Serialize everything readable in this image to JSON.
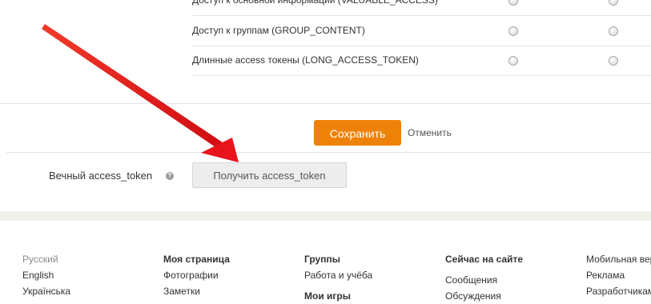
{
  "permissions": {
    "rows": [
      {
        "label": "Доступ к основной информации (VALUABLE_ACCESS)"
      },
      {
        "label": "Доступ к группам (GROUP_CONTENT)"
      },
      {
        "label": "Длинные access токены (LONG_ACCESS_TOKEN)"
      }
    ]
  },
  "actions": {
    "save_label": "Сохранить",
    "cancel_label": "Отменить"
  },
  "token": {
    "label": "Вечный access_token",
    "help_glyph": "?",
    "button_label": "Получить access_token"
  },
  "footer": {
    "languages": [
      "Русский",
      "English",
      "Українська"
    ],
    "col_my_page": {
      "title": "Моя страница",
      "items": [
        "Фотографии",
        "Заметки"
      ]
    },
    "col_groups": {
      "title": "Группы",
      "items": [
        "Работа и учёба"
      ],
      "title2": "Мои игры"
    },
    "col_now": {
      "title": "Сейчас на сайте",
      "items": [
        "Сообщения",
        "Обсуждения"
      ]
    },
    "col_more": {
      "items": [
        "Мобильная вер",
        "Реклама",
        "Разработчикам"
      ]
    }
  },
  "colors": {
    "accent": "#ee8208",
    "arrow": "#e8141b"
  },
  "icons": {
    "help": "help-icon",
    "arrow": "annotation-arrow"
  }
}
